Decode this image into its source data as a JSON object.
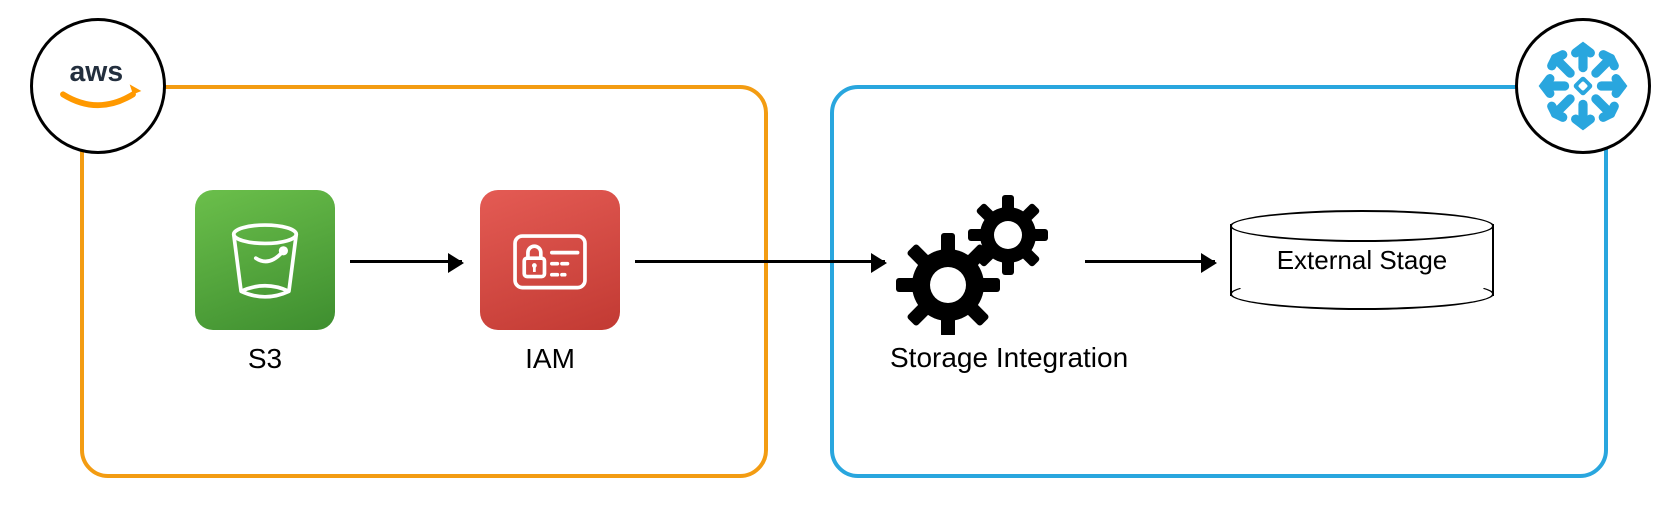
{
  "aws_badge": {
    "label": "aws"
  },
  "snowflake_badge": {
    "label": "snowflake"
  },
  "nodes": {
    "s3": {
      "label": "S3"
    },
    "iam": {
      "label": "IAM"
    },
    "storage_integration": {
      "label": "Storage Integration"
    },
    "external_stage": {
      "label": "External Stage"
    }
  },
  "colors": {
    "aws_box": "#f39c12",
    "snowflake_box": "#29a6de",
    "s3_tile": "#3e8e2f",
    "iam_tile": "#c23a33",
    "snowflake_icon": "#29a6de"
  },
  "flow": [
    "S3",
    "IAM",
    "Storage Integration",
    "External Stage"
  ]
}
